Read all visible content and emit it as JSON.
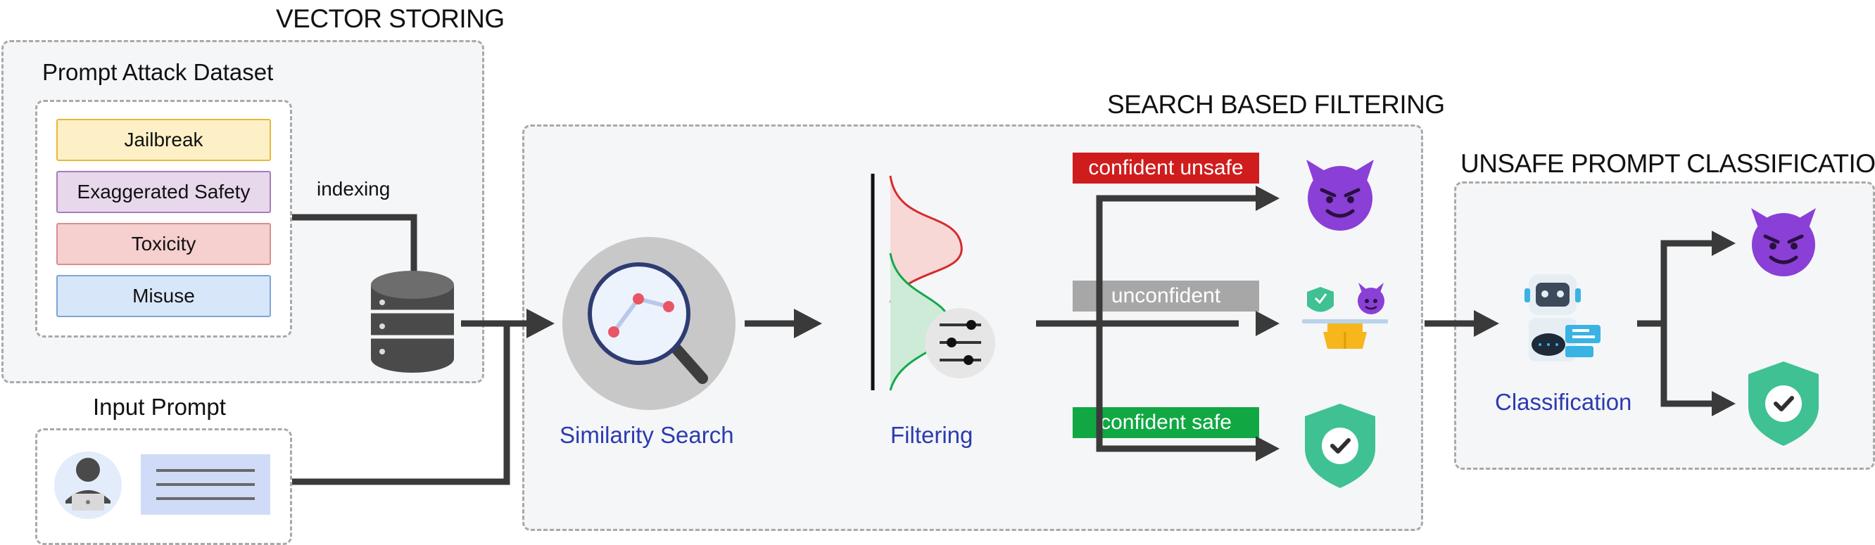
{
  "sections": {
    "vector_storing": "VECTOR STORING",
    "search_based_filtering": "SEARCH BASED FILTERING",
    "unsafe_prompt_classification": "UNSAFE PROMPT CLASSIFICATION"
  },
  "dataset": {
    "title": "Prompt Attack Dataset",
    "categories": [
      {
        "label": "Jailbreak",
        "fill": "#fdf0c6",
        "border": "#e6b93a"
      },
      {
        "label": "Exaggerated Safety",
        "fill": "#e7d8ec",
        "border": "#a97bbd"
      },
      {
        "label": "Toxicity",
        "fill": "#f6cfcf",
        "border": "#d98e8e"
      },
      {
        "label": "Misuse",
        "fill": "#d8e6f9",
        "border": "#7fa3d6"
      }
    ]
  },
  "indexing_label": "indexing",
  "input_prompt": {
    "title": "Input Prompt"
  },
  "steps": {
    "similarity_search": "Similarity Search",
    "filtering": "Filtering",
    "classification": "Classification"
  },
  "tags": {
    "confident_unsafe": {
      "label": "confident unsafe",
      "color": "#cf1d1d"
    },
    "unconfident": {
      "label": "unconfident",
      "color": "#a7a7a7"
    },
    "confident_safe": {
      "label": "confident safe",
      "color": "#11a843"
    }
  },
  "colors": {
    "arrow": "#3a3a3a",
    "accent_text": "#2b3bb0",
    "devil": "#8a3fd6",
    "shield": "#3fc194"
  }
}
